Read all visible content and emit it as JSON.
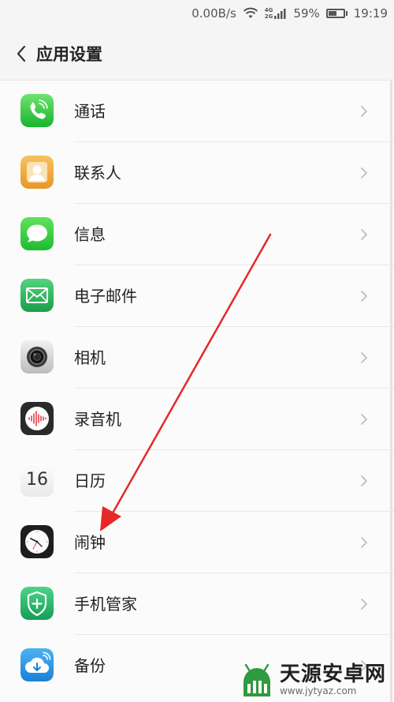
{
  "status_bar": {
    "net_speed": "0.00B/s",
    "net_4g": "4G",
    "net_2g": "2G",
    "battery": "59%",
    "battery_level": 0.59,
    "time": "19:19"
  },
  "header": {
    "title": "应用设置"
  },
  "items": [
    {
      "label": "通话"
    },
    {
      "label": "联系人"
    },
    {
      "label": "信息"
    },
    {
      "label": "电子邮件"
    },
    {
      "label": "相机"
    },
    {
      "label": "录音机"
    },
    {
      "label": "日历",
      "icon_text": "16"
    },
    {
      "label": "闹钟"
    },
    {
      "label": "手机管家"
    },
    {
      "label": "备份"
    }
  ],
  "watermark": {
    "name": "天源安卓网",
    "url": "www.jytyaz.com"
  },
  "colors": {
    "annotation_arrow": "#e62828",
    "green": "#2fd14a",
    "orange": "#f1a83e"
  }
}
